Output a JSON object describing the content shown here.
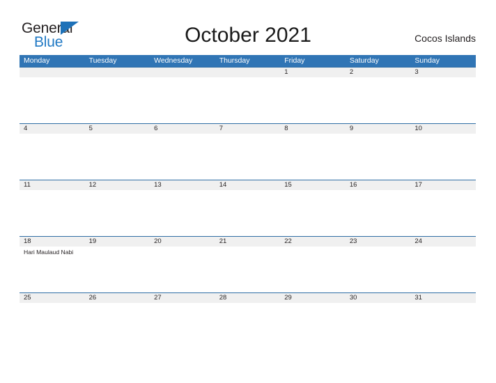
{
  "brand": {
    "name_top": "General",
    "name_bottom": "Blue",
    "flag_icon": "triangle-flag-icon",
    "color_dark": "#231f20",
    "color_blue": "#2079c4",
    "flag_color": "#1d71b8"
  },
  "header": {
    "title": "October 2021",
    "region": "Cocos Islands"
  },
  "calendar": {
    "header_bg": "#3075b5",
    "date_band_bg": "#f0f0f0",
    "row_border_color": "#2e6da4",
    "weekdays": [
      "Monday",
      "Tuesday",
      "Wednesday",
      "Thursday",
      "Friday",
      "Saturday",
      "Sunday"
    ],
    "weeks": [
      {
        "days": [
          {
            "date": "",
            "event": ""
          },
          {
            "date": "",
            "event": ""
          },
          {
            "date": "",
            "event": ""
          },
          {
            "date": "",
            "event": ""
          },
          {
            "date": "1",
            "event": ""
          },
          {
            "date": "2",
            "event": ""
          },
          {
            "date": "3",
            "event": ""
          }
        ]
      },
      {
        "days": [
          {
            "date": "4",
            "event": ""
          },
          {
            "date": "5",
            "event": ""
          },
          {
            "date": "6",
            "event": ""
          },
          {
            "date": "7",
            "event": ""
          },
          {
            "date": "8",
            "event": ""
          },
          {
            "date": "9",
            "event": ""
          },
          {
            "date": "10",
            "event": ""
          }
        ]
      },
      {
        "days": [
          {
            "date": "11",
            "event": ""
          },
          {
            "date": "12",
            "event": ""
          },
          {
            "date": "13",
            "event": ""
          },
          {
            "date": "14",
            "event": ""
          },
          {
            "date": "15",
            "event": ""
          },
          {
            "date": "16",
            "event": ""
          },
          {
            "date": "17",
            "event": ""
          }
        ]
      },
      {
        "days": [
          {
            "date": "18",
            "event": "Hari Maulaud Nabi"
          },
          {
            "date": "19",
            "event": ""
          },
          {
            "date": "20",
            "event": ""
          },
          {
            "date": "21",
            "event": ""
          },
          {
            "date": "22",
            "event": ""
          },
          {
            "date": "23",
            "event": ""
          },
          {
            "date": "24",
            "event": ""
          }
        ]
      },
      {
        "days": [
          {
            "date": "25",
            "event": ""
          },
          {
            "date": "26",
            "event": ""
          },
          {
            "date": "27",
            "event": ""
          },
          {
            "date": "28",
            "event": ""
          },
          {
            "date": "29",
            "event": ""
          },
          {
            "date": "30",
            "event": ""
          },
          {
            "date": "31",
            "event": ""
          }
        ]
      }
    ]
  }
}
